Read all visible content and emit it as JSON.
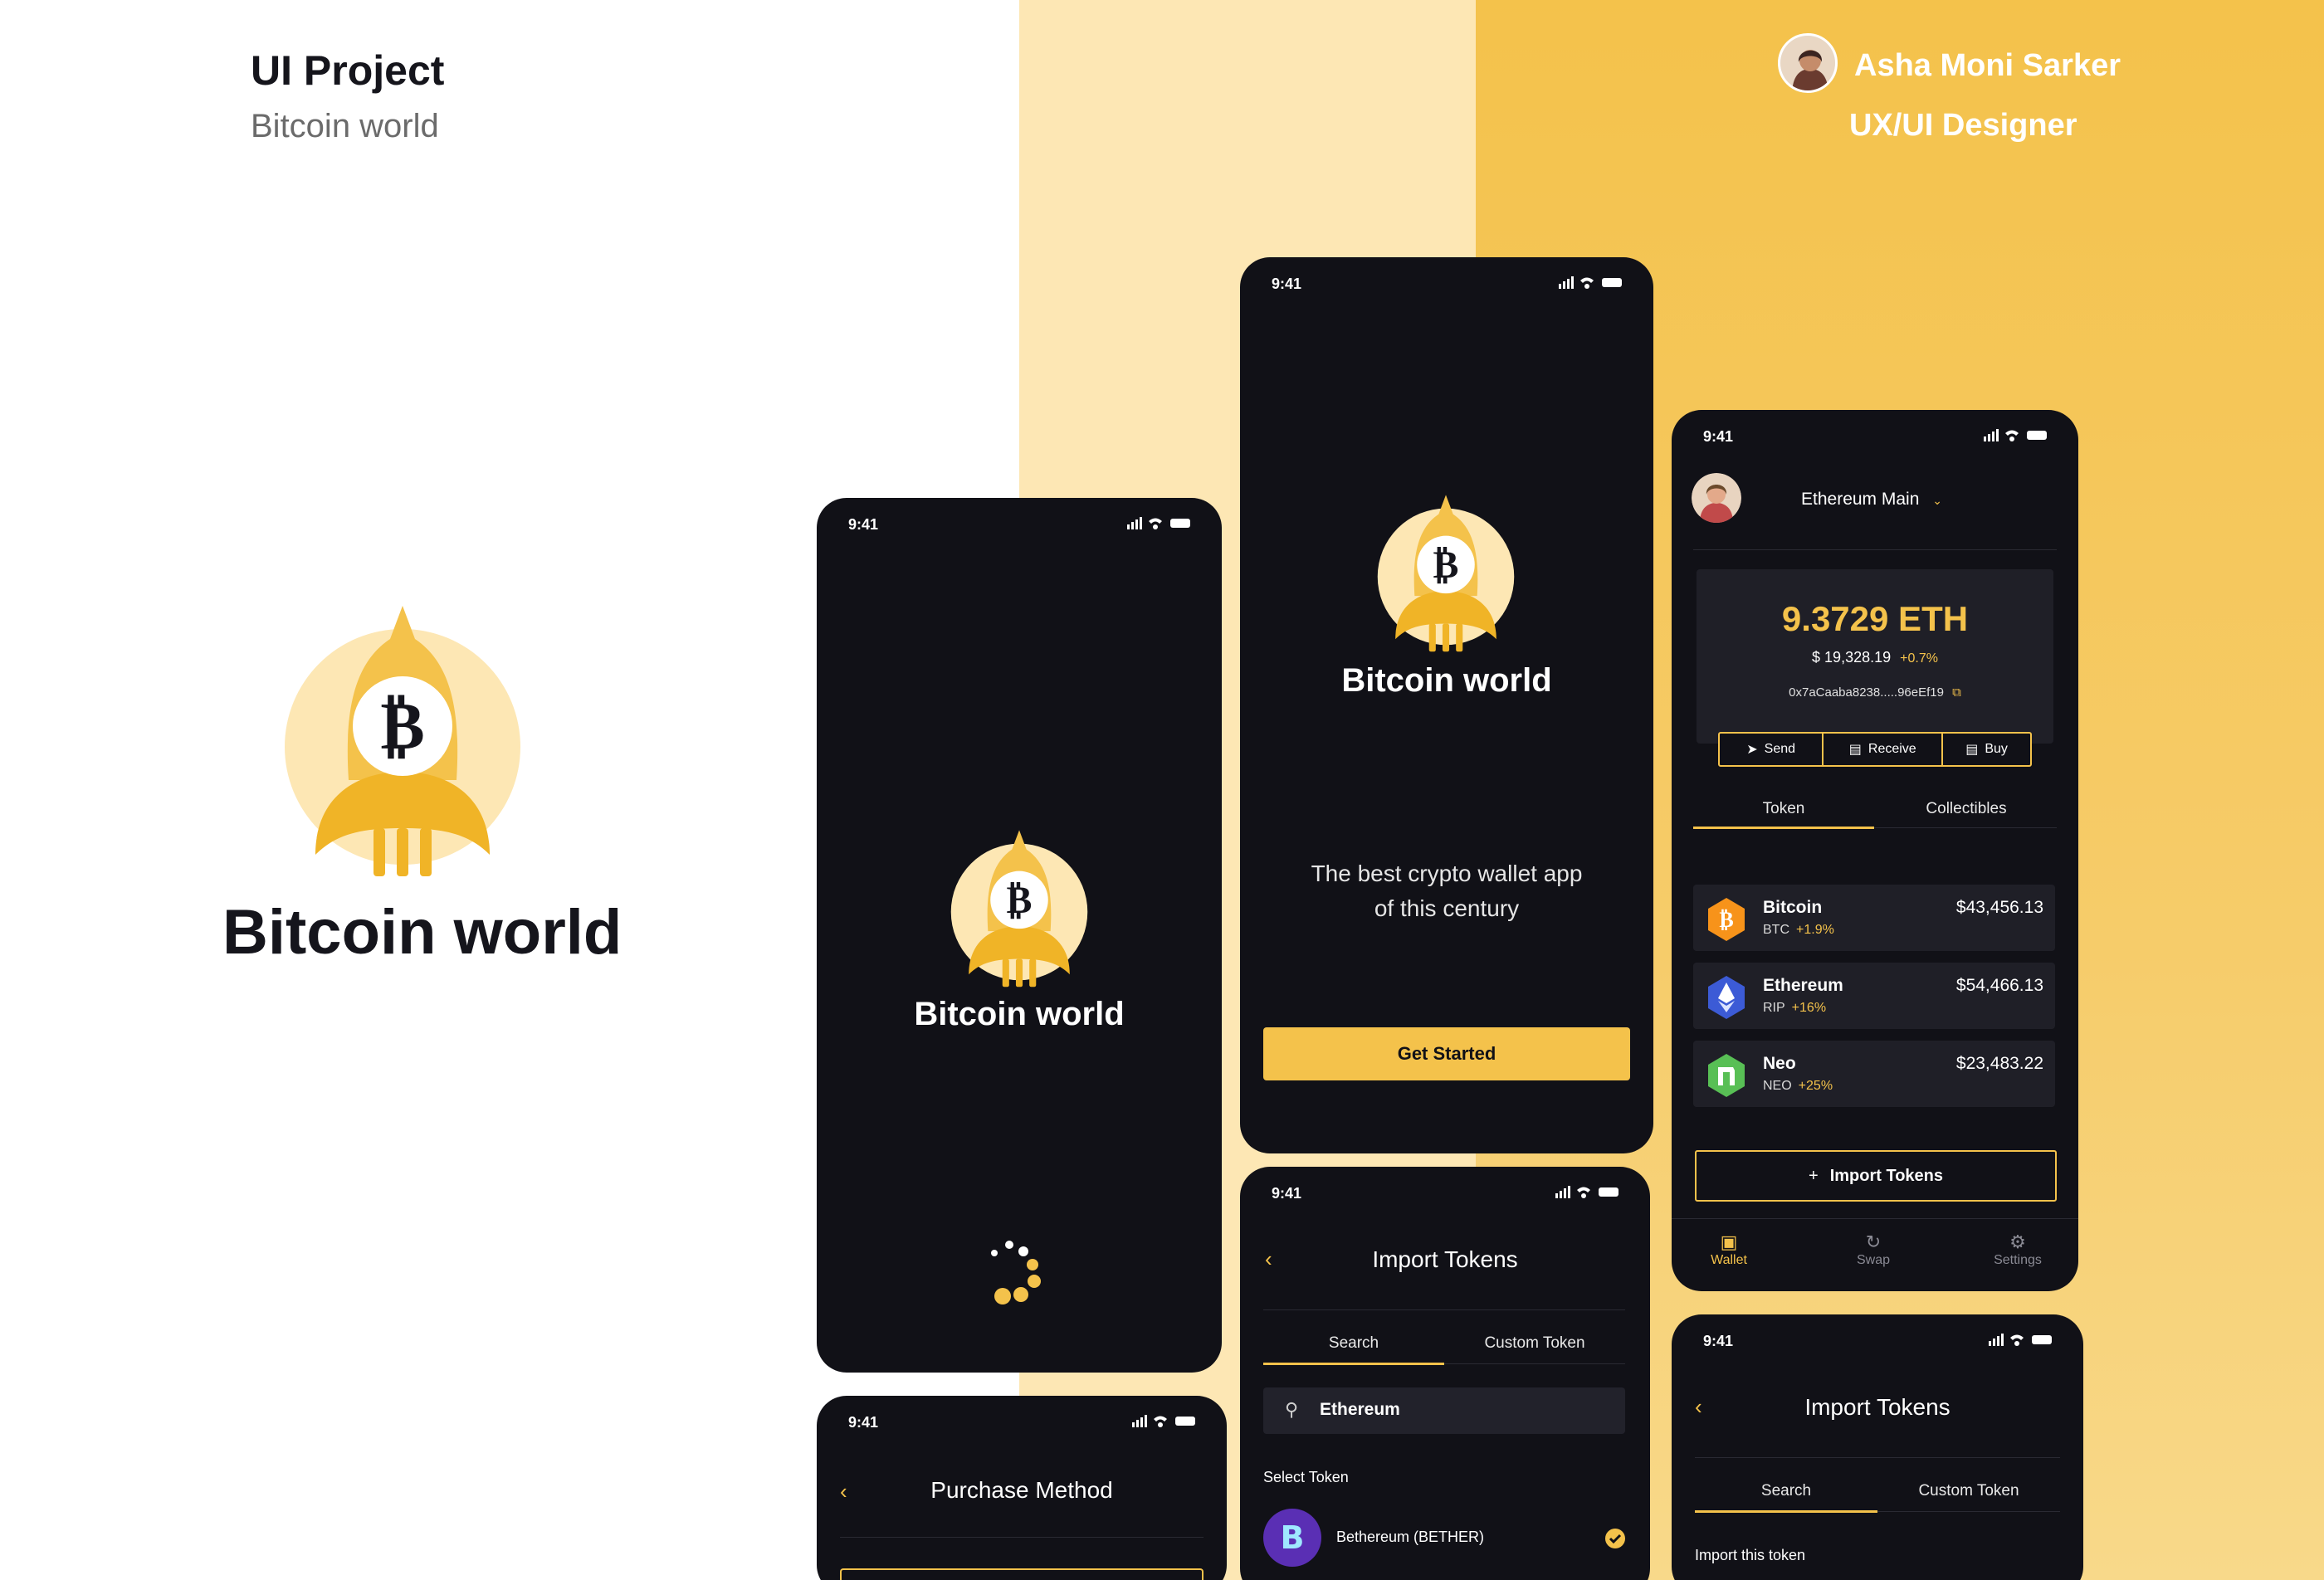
{
  "header": {
    "project_label": "UI Project",
    "project_name": "Bitcoin world",
    "designer_name": "Asha Moni Sarker",
    "designer_role": "UX/UI Designer"
  },
  "brand": {
    "name": "Bitcoin world"
  },
  "status_bar": {
    "time": "9:41"
  },
  "colors": {
    "accent": "#f4c24b",
    "dark": "#111117",
    "card": "#1f1f27",
    "cream": "#fde7b4"
  },
  "splash": {
    "brand": "Bitcoin world"
  },
  "onboarding": {
    "brand": "Bitcoin world",
    "tagline_line1": "The best crypto wallet app",
    "tagline_line2": "of this century",
    "cta": "Get Started"
  },
  "wallet": {
    "network": "Ethereum Main",
    "balance": "9.3729 ETH",
    "fiat": "$ 19,328.19",
    "fiat_change": "+0.7%",
    "address": "0x7aCaaba8238.....96eEf19",
    "actions": [
      "Send",
      "Receive",
      "Buy"
    ],
    "tabs": [
      "Token",
      "Collectibles"
    ],
    "tokens": [
      {
        "name": "Bitcoin",
        "symbol": "BTC",
        "change": "+1.9%",
        "value": "$43,456.13",
        "icon": "bitcoin-icon"
      },
      {
        "name": "Ethereum",
        "symbol": "RIP",
        "change": "+16%",
        "value": "$54,466.13",
        "icon": "ethereum-icon"
      },
      {
        "name": "Neo",
        "symbol": "NEO",
        "change": "+25%",
        "value": "$23,483.22",
        "icon": "neo-icon"
      }
    ],
    "import_label": "Import Tokens",
    "bottom_nav": [
      "Wallet",
      "Swap",
      "Settings"
    ]
  },
  "purchase": {
    "title": "Purchase Method"
  },
  "import_search": {
    "title": "Import Tokens",
    "tabs": [
      "Search",
      "Custom Token"
    ],
    "search_value": "Ethereum",
    "section_label": "Select Token",
    "result": "Bethereum (BETHER)"
  },
  "import_token": {
    "title": "Import Tokens",
    "tabs": [
      "Search",
      "Custom Token"
    ],
    "section_label": "Import this token"
  }
}
